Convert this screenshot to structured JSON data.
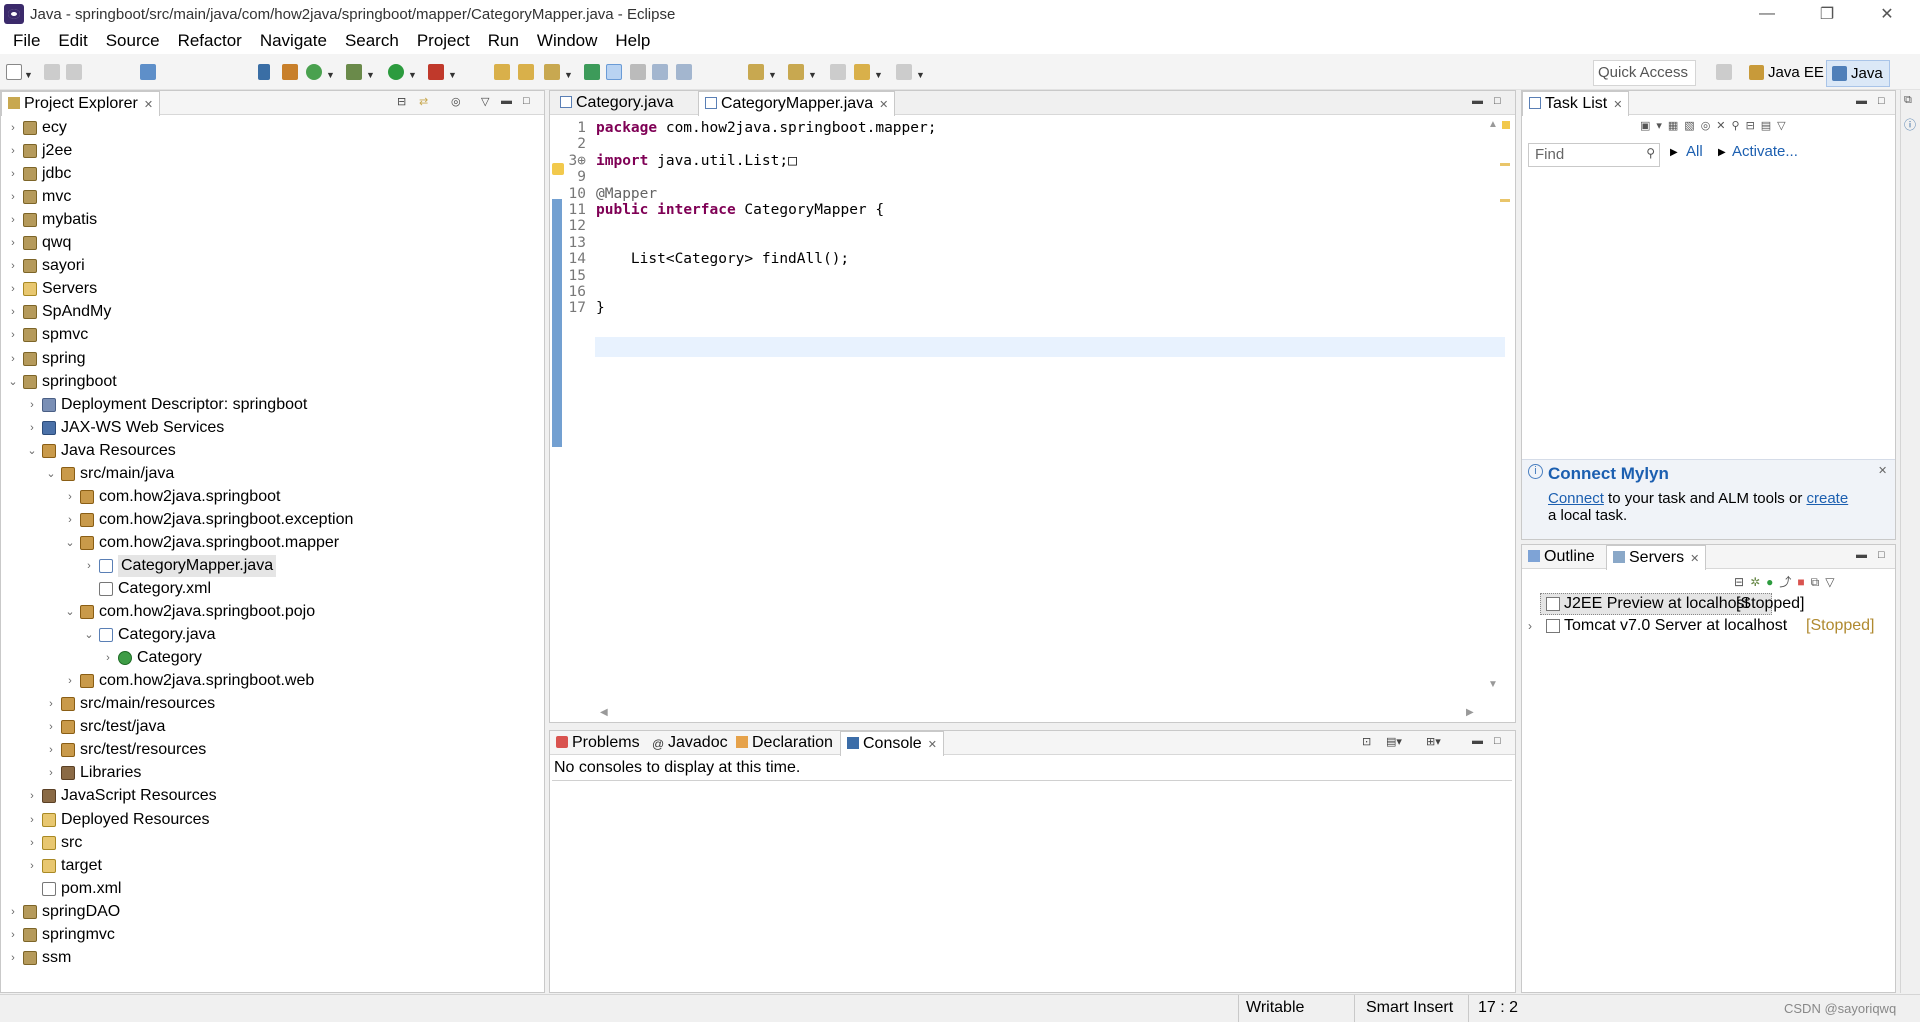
{
  "window": {
    "title": "Java - springboot/src/main/java/com/how2java/springboot/mapper/CategoryMapper.java - Eclipse",
    "minimize": "—",
    "restore": "❐",
    "close": "✕"
  },
  "menu": [
    "File",
    "Edit",
    "Source",
    "Refactor",
    "Navigate",
    "Search",
    "Project",
    "Run",
    "Window",
    "Help"
  ],
  "toolbar": {
    "quick_access": "Quick Access",
    "perspectives": [
      {
        "label": "Java EE",
        "active": false
      },
      {
        "label": "Java",
        "active": true
      }
    ]
  },
  "project_explorer": {
    "tab": "Project Explorer",
    "items": [
      {
        "label": "ecy",
        "depth": 0,
        "chev": "›",
        "icon": "project"
      },
      {
        "label": "j2ee",
        "depth": 0,
        "chev": "›",
        "icon": "project"
      },
      {
        "label": "jdbc",
        "depth": 0,
        "chev": "›",
        "icon": "project"
      },
      {
        "label": "mvc",
        "depth": 0,
        "chev": "›",
        "icon": "project"
      },
      {
        "label": "mybatis",
        "depth": 0,
        "chev": "›",
        "icon": "project"
      },
      {
        "label": "qwq",
        "depth": 0,
        "chev": "›",
        "icon": "project"
      },
      {
        "label": "sayori",
        "depth": 0,
        "chev": "›",
        "icon": "project"
      },
      {
        "label": "Servers",
        "depth": 0,
        "chev": "›",
        "icon": "folder"
      },
      {
        "label": "SpAndMy",
        "depth": 0,
        "chev": "›",
        "icon": "project"
      },
      {
        "label": "spmvc",
        "depth": 0,
        "chev": "›",
        "icon": "project"
      },
      {
        "label": "spring",
        "depth": 0,
        "chev": "›",
        "icon": "project"
      },
      {
        "label": "springboot",
        "depth": 0,
        "chev": "⌄",
        "icon": "project"
      },
      {
        "label": "Deployment Descriptor: springboot",
        "depth": 1,
        "chev": "›",
        "icon": "descriptor"
      },
      {
        "label": "JAX-WS Web Services",
        "depth": 1,
        "chev": "›",
        "icon": "webservice"
      },
      {
        "label": "Java Resources",
        "depth": 1,
        "chev": "⌄",
        "icon": "package"
      },
      {
        "label": "src/main/java",
        "depth": 2,
        "chev": "⌄",
        "icon": "package"
      },
      {
        "label": "com.how2java.springboot",
        "depth": 3,
        "chev": "›",
        "icon": "package"
      },
      {
        "label": "com.how2java.springboot.exception",
        "depth": 3,
        "chev": "›",
        "icon": "package"
      },
      {
        "label": "com.how2java.springboot.mapper",
        "depth": 3,
        "chev": "⌄",
        "icon": "package"
      },
      {
        "label": "CategoryMapper.java",
        "depth": 4,
        "chev": "›",
        "icon": "javafile",
        "selected": true
      },
      {
        "label": "Category.xml",
        "depth": 4,
        "chev": "",
        "icon": "xmlfile"
      },
      {
        "label": "com.how2java.springboot.pojo",
        "depth": 3,
        "chev": "⌄",
        "icon": "package"
      },
      {
        "label": "Category.java",
        "depth": 4,
        "chev": "⌄",
        "icon": "javafile"
      },
      {
        "label": "Category",
        "depth": 5,
        "chev": "›",
        "icon": "class"
      },
      {
        "label": "com.how2java.springboot.web",
        "depth": 3,
        "chev": "›",
        "icon": "package"
      },
      {
        "label": "src/main/resources",
        "depth": 2,
        "chev": "›",
        "icon": "package"
      },
      {
        "label": "src/test/java",
        "depth": 2,
        "chev": "›",
        "icon": "package"
      },
      {
        "label": "src/test/resources",
        "depth": 2,
        "chev": "›",
        "icon": "package"
      },
      {
        "label": "Libraries",
        "depth": 2,
        "chev": "›",
        "icon": "library"
      },
      {
        "label": "JavaScript Resources",
        "depth": 1,
        "chev": "›",
        "icon": "library"
      },
      {
        "label": "Deployed Resources",
        "depth": 1,
        "chev": "›",
        "icon": "folder"
      },
      {
        "label": "src",
        "depth": 1,
        "chev": "›",
        "icon": "folder"
      },
      {
        "label": "target",
        "depth": 1,
        "chev": "›",
        "icon": "folder"
      },
      {
        "label": "pom.xml",
        "depth": 1,
        "chev": "",
        "icon": "xmlfile"
      },
      {
        "label": "springDAO",
        "depth": 0,
        "chev": "›",
        "icon": "project"
      },
      {
        "label": "springmvc",
        "depth": 0,
        "chev": "›",
        "icon": "project"
      },
      {
        "label": "ssm",
        "depth": 0,
        "chev": "›",
        "icon": "project"
      }
    ]
  },
  "editor": {
    "tabs": [
      {
        "label": "Category.java",
        "active": false
      },
      {
        "label": "CategoryMapper.java",
        "active": true
      }
    ],
    "lines": [
      {
        "num": "1",
        "parts": [
          {
            "t": "package",
            "c": "kw"
          },
          {
            "t": " com.how2java.springboot.mapper;",
            "c": ""
          }
        ]
      },
      {
        "num": "2",
        "parts": []
      },
      {
        "num": "3⊕",
        "parts": [
          {
            "t": "import",
            "c": "kw"
          },
          {
            "t": " java.util.List;",
            "c": ""
          },
          {
            "t": "□",
            "c": ""
          }
        ]
      },
      {
        "num": "9",
        "parts": []
      },
      {
        "num": "10",
        "parts": [
          {
            "t": "@Mapper",
            "c": "ann"
          }
        ]
      },
      {
        "num": "11",
        "parts": [
          {
            "t": "public",
            "c": "kw"
          },
          {
            "t": " ",
            "c": ""
          },
          {
            "t": "interface",
            "c": "kw"
          },
          {
            "t": " CategoryMapper {",
            "c": ""
          }
        ]
      },
      {
        "num": "12",
        "parts": []
      },
      {
        "num": "13",
        "parts": []
      },
      {
        "num": "14",
        "parts": [
          {
            "t": "    List<Category> findAll();",
            "c": ""
          }
        ]
      },
      {
        "num": "15",
        "parts": []
      },
      {
        "num": "16",
        "parts": []
      },
      {
        "num": "17",
        "parts": [
          {
            "t": "}",
            "c": ""
          }
        ]
      }
    ]
  },
  "console_area": {
    "tabs": [
      {
        "label": "Problems",
        "active": false
      },
      {
        "label": "Javadoc",
        "active": false
      },
      {
        "label": "Declaration",
        "active": false
      },
      {
        "label": "Console",
        "active": true
      }
    ],
    "message": "No consoles to display at this time."
  },
  "task_list": {
    "tab": "Task List",
    "find_placeholder": "Find",
    "all_label": "All",
    "activate_label": "Activate...",
    "mylyn_title": "Connect Mylyn",
    "mylyn_connect": "Connect",
    "mylyn_text1": " to your task and ALM tools or ",
    "mylyn_create": "create",
    "mylyn_text2": "a local task."
  },
  "servers_area": {
    "tabs": [
      {
        "label": "Outline",
        "active": false
      },
      {
        "label": "Servers",
        "active": true
      }
    ],
    "servers": [
      {
        "name": "J2EE Preview at localhost",
        "status": "[Stopped]",
        "selected": true,
        "chev": ""
      },
      {
        "name": "Tomcat v7.0 Server at localhost",
        "status": "[Stopped]",
        "selected": false,
        "chev": "›"
      }
    ]
  },
  "status_bar": {
    "writable": "Writable",
    "insert_mode": "Smart Insert",
    "position": "17 : 2",
    "watermark": "CSDN @sayoriqwq"
  },
  "colors": {
    "keyword": "#7f0055",
    "annotation": "#646464",
    "link": "#1c5fb0",
    "current_line": "#e8f2fe",
    "selection": "#e5e5e5"
  }
}
